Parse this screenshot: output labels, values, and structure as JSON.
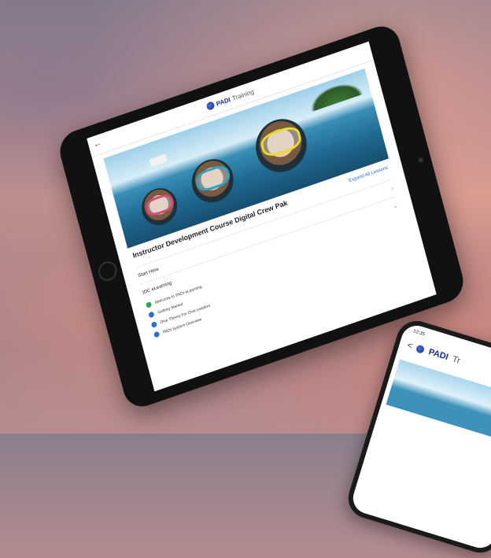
{
  "tablet": {
    "app": {
      "logo_brand": "PADI",
      "logo_sub": "Training",
      "back_glyph": "←"
    },
    "page_title": "Instructor Development Course Digital Crew Pak",
    "outline_link": "Expand All Lessons",
    "sections": [
      {
        "label": "Start Here"
      },
      {
        "label": "IDC eLearning"
      }
    ],
    "lessons": [
      {
        "label": "Welcome to PADI eLearning",
        "done": true
      },
      {
        "label": "Getting Started",
        "done": false
      },
      {
        "label": "Dive Theory For Dive Leaders",
        "done": false
      },
      {
        "label": "PADI System Overview",
        "done": false
      }
    ]
  },
  "phone": {
    "time": "12:35",
    "logo_brand": "PADI",
    "logo_sub": "Tr",
    "back_glyph": "<"
  },
  "colors": {
    "accent": "#2b6fd0",
    "done": "#27a85a",
    "brand": "#1a2f8a"
  }
}
